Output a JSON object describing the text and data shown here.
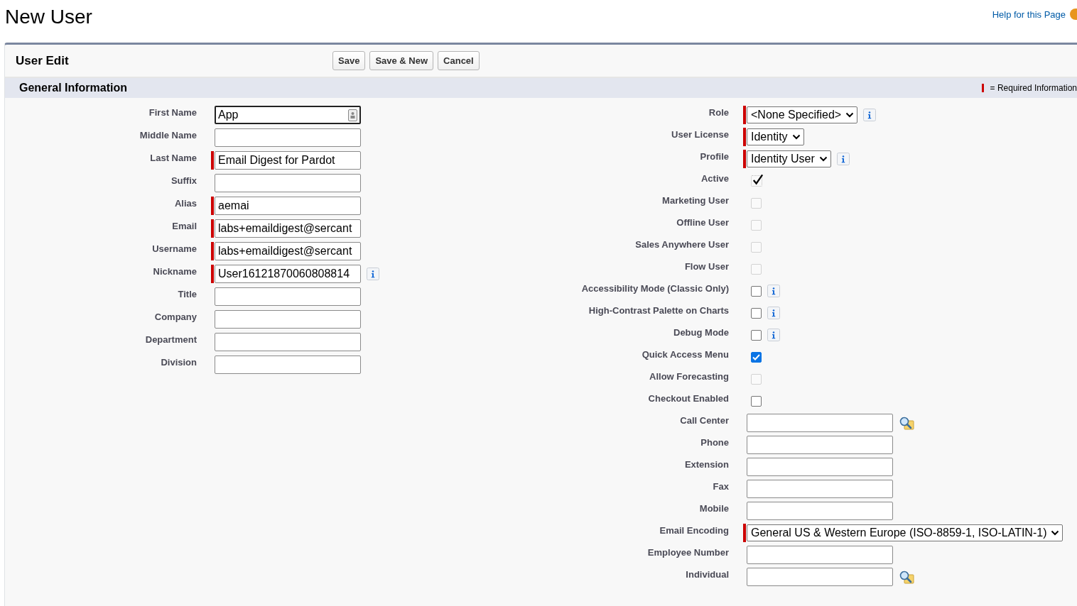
{
  "page_title": "New User",
  "help_link": "Help for this Page",
  "panel": {
    "title": "User Edit",
    "buttons": [
      "Save",
      "Save & New",
      "Cancel"
    ]
  },
  "section": {
    "title": "General Information",
    "legend": "= Required Information"
  },
  "left_fields": [
    {
      "label": "First Name",
      "value": "App",
      "required": false,
      "focused": true,
      "card_icon": true
    },
    {
      "label": "Middle Name",
      "required": false,
      "focused": false
    },
    {
      "label": "Last Name",
      "value": "Email Digest for Pardot",
      "required": true,
      "focused": false
    },
    {
      "label": "Suffix",
      "required": false,
      "focused": false
    },
    {
      "label": "Alias",
      "value": "aemai",
      "required": true,
      "focused": false
    },
    {
      "label": "Email",
      "value": "labs+emaildigest@sercant",
      "required": true,
      "focused": false
    },
    {
      "label": "Username",
      "value": "labs+emaildigest@sercant",
      "required": true,
      "focused": false
    },
    {
      "label": "Nickname",
      "value": "User16121870060808814",
      "required": true,
      "focused": false,
      "info": true
    },
    {
      "label": "Title",
      "required": false,
      "focused": false
    },
    {
      "label": "Company",
      "required": false,
      "focused": false
    },
    {
      "label": "Department",
      "required": false,
      "focused": false
    },
    {
      "label": "Division",
      "required": false,
      "focused": false
    }
  ],
  "right_fields": [
    {
      "kind": "select",
      "label": "Role",
      "value": "<None Specified>",
      "required": true,
      "info": true
    },
    {
      "kind": "select",
      "label": "User License",
      "value": "Identity",
      "required": true
    },
    {
      "kind": "select",
      "label": "Profile",
      "value": "Identity User",
      "required": true,
      "info": true
    },
    {
      "kind": "checkbox",
      "label": "Active",
      "checked": true,
      "disabled": true
    },
    {
      "kind": "checkbox",
      "label": "Marketing User",
      "checked": false,
      "disabled": true
    },
    {
      "kind": "checkbox",
      "label": "Offline User",
      "checked": false,
      "disabled": true
    },
    {
      "kind": "checkbox",
      "label": "Sales Anywhere User",
      "checked": false,
      "disabled": true
    },
    {
      "kind": "checkbox",
      "label": "Flow User",
      "checked": false,
      "disabled": true
    },
    {
      "kind": "checkbox",
      "label": "Accessibility Mode (Classic Only)",
      "checked": false,
      "disabled": false,
      "info": true
    },
    {
      "kind": "checkbox",
      "label": "High-Contrast Palette on Charts",
      "checked": false,
      "disabled": false,
      "info": true
    },
    {
      "kind": "checkbox",
      "label": "Debug Mode",
      "checked": false,
      "disabled": false,
      "info": true
    },
    {
      "kind": "checkbox",
      "label": "Quick Access Menu",
      "checked": true,
      "disabled": false
    },
    {
      "kind": "checkbox",
      "label": "Allow Forecasting",
      "checked": false,
      "disabled": true
    },
    {
      "kind": "checkbox",
      "label": "Checkout Enabled",
      "checked": false,
      "disabled": false
    },
    {
      "kind": "lookup",
      "label": "Call Center"
    },
    {
      "kind": "text",
      "label": "Phone"
    },
    {
      "kind": "text",
      "label": "Extension"
    },
    {
      "kind": "text",
      "label": "Fax"
    },
    {
      "kind": "text",
      "label": "Mobile"
    },
    {
      "kind": "select",
      "label": "Email Encoding",
      "value": "General US & Western Europe (ISO-8859-1, ISO-LATIN-1)",
      "required": true
    },
    {
      "kind": "text",
      "label": "Employee Number"
    },
    {
      "kind": "lookup",
      "label": "Individual"
    }
  ]
}
